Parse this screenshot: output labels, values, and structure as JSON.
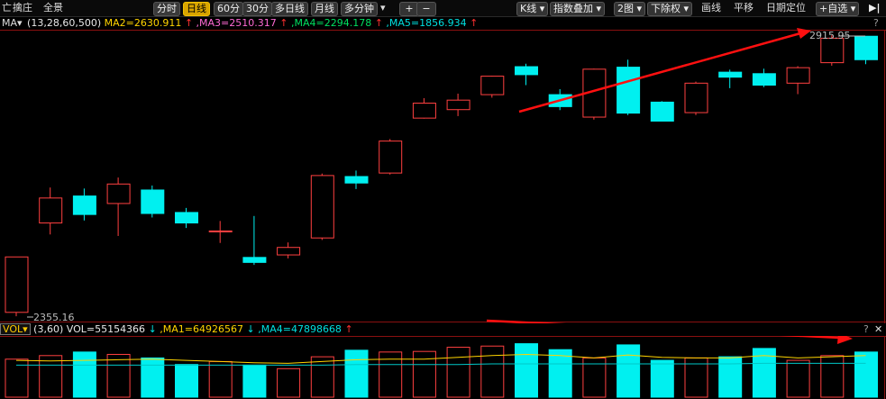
{
  "toolbar": {
    "left_items": [
      "亡",
      "擒庄",
      "全景"
    ],
    "period_buttons": [
      "分时",
      "日线",
      "60分",
      "30分",
      "多日线",
      "月线",
      "多分钟"
    ],
    "active_period": "日线",
    "plus": "+",
    "minus": "−",
    "right_items": [
      "K线",
      "指数叠加",
      "2图",
      "下除权",
      "画线",
      "平移",
      "日期定位",
      "+自选"
    ],
    "expand": "▶|"
  },
  "ma_bar": {
    "tag": "MA",
    "params": "(13,28,60,500)",
    "ma2": "MA2=2630.911",
    "ma3": ",MA3=2510.317",
    "ma4": ",MA4=2294.178",
    "ma5": ",MA5=1856.934",
    "colors": {
      "params": "#e8e8e8",
      "ma2": "#ffd400",
      "ma3": "#ff6ad5",
      "ma4": "#00e060",
      "ma5": "#00e0e0",
      "up": "#ff3030"
    }
  },
  "vol_bar": {
    "tag": "VOL",
    "params": "(3,60)",
    "vol": "VOL=55154366",
    "ma1": ",MA1=64926567",
    "ma4": ",MA4=47898668",
    "help": "?",
    "close": "✕"
  },
  "main_help": "?",
  "chart_data": {
    "type": "candlestick",
    "price_labels": {
      "high": "2915.95",
      "low": "2355.16"
    },
    "candles": [
      {
        "open": 2363,
        "close": 2474,
        "high": 2474,
        "low": 2355.16
      },
      {
        "open": 2542,
        "close": 2592,
        "high": 2613,
        "low": 2519
      },
      {
        "open": 2596,
        "close": 2559,
        "high": 2611,
        "low": 2547
      },
      {
        "open": 2581,
        "close": 2620,
        "high": 2633,
        "low": 2516
      },
      {
        "open": 2608,
        "close": 2561,
        "high": 2617,
        "low": 2553
      },
      {
        "open": 2563,
        "close": 2542,
        "high": 2572,
        "low": 2532
      },
      {
        "open": 2526,
        "close": 2526,
        "high": 2546,
        "low": 2502
      },
      {
        "open": 2473,
        "close": 2463,
        "high": 2556,
        "low": 2458
      },
      {
        "open": 2478,
        "close": 2493,
        "high": 2503,
        "low": 2471
      },
      {
        "open": 2512,
        "close": 2637,
        "high": 2641,
        "low": 2508
      },
      {
        "open": 2635,
        "close": 2622,
        "high": 2647,
        "low": 2610
      },
      {
        "open": 2642,
        "close": 2706,
        "high": 2710,
        "low": 2639
      },
      {
        "open": 2752,
        "close": 2782,
        "high": 2792,
        "low": 2751
      },
      {
        "open": 2769,
        "close": 2788,
        "high": 2801,
        "low": 2756
      },
      {
        "open": 2799,
        "close": 2836,
        "high": 2837,
        "low": 2793
      },
      {
        "open": 2855,
        "close": 2839,
        "high": 2861,
        "low": 2818
      },
      {
        "open": 2799,
        "close": 2775,
        "high": 2810,
        "low": 2768
      },
      {
        "open": 2754,
        "close": 2850,
        "high": 2851,
        "low": 2749
      },
      {
        "open": 2854,
        "close": 2762,
        "high": 2869,
        "low": 2758
      },
      {
        "open": 2784,
        "close": 2746,
        "high": 2786,
        "low": 2746
      },
      {
        "open": 2763,
        "close": 2822,
        "high": 2825,
        "low": 2758
      },
      {
        "open": 2844,
        "close": 2834,
        "high": 2849,
        "low": 2812
      },
      {
        "open": 2841,
        "close": 2818,
        "high": 2851,
        "low": 2814
      },
      {
        "open": 2822,
        "close": 2853,
        "high": 2856,
        "low": 2800
      },
      {
        "open": 2863,
        "close": 2912,
        "high": 2918,
        "low": 2857
      },
      {
        "open": 2915.95,
        "close": 2869,
        "high": 2915.95,
        "low": 2860
      }
    ],
    "volume": [
      64,
      70,
      76,
      72,
      66,
      55,
      60,
      54,
      48,
      68,
      79,
      76,
      77,
      84,
      86,
      90,
      80,
      66,
      88,
      62,
      66,
      68,
      82,
      62,
      70,
      76
    ],
    "volume_ma": [
      62,
      61,
      62,
      63,
      64,
      62,
      60,
      58,
      57,
      60,
      63,
      64,
      64,
      67,
      70,
      72,
      70,
      66,
      71,
      67,
      66,
      66,
      70,
      66,
      68,
      70
    ],
    "volume_ma_long": [
      54,
      54,
      54,
      54,
      54,
      54,
      54,
      54,
      54,
      54,
      55,
      55,
      55,
      55,
      56,
      56,
      56,
      56,
      56,
      56,
      56,
      56,
      57,
      57,
      57,
      57
    ],
    "colors": {
      "up": "#ff4040",
      "down": "#00f0f0",
      "vol_ma": "#ffd400",
      "vol_ma_long": "#00e0e0",
      "arrow": "#ff1010"
    }
  }
}
